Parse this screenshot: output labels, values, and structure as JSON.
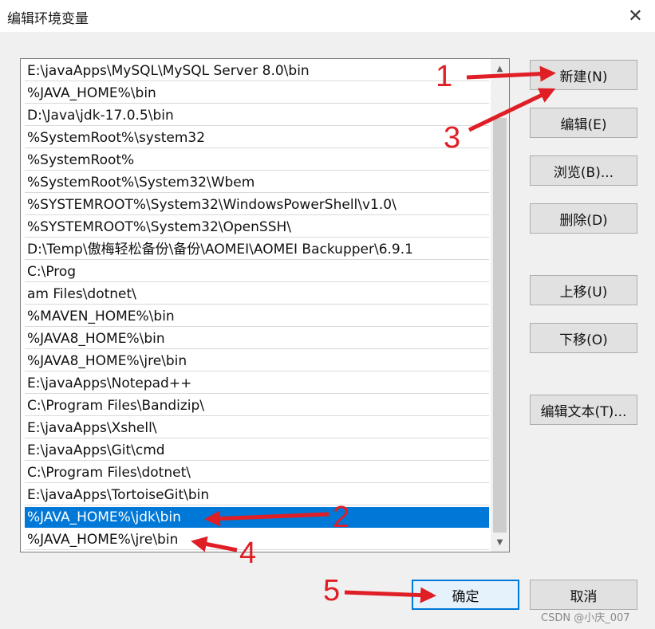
{
  "window": {
    "title": "编辑环境变量",
    "close_glyph": "✕"
  },
  "list": {
    "items": [
      "E:\\javaApps\\MySQL\\MySQL Server 8.0\\bin",
      "%JAVA_HOME%\\bin",
      "D:\\Java\\jdk-17.0.5\\bin",
      "%SystemRoot%\\system32",
      "%SystemRoot%",
      "%SystemRoot%\\System32\\Wbem",
      "%SYSTEMROOT%\\System32\\WindowsPowerShell\\v1.0\\",
      "%SYSTEMROOT%\\System32\\OpenSSH\\",
      "D:\\Temp\\傲梅轻松备份\\备份\\AOMEI\\AOMEI Backupper\\6.9.1",
      "C:\\Prog",
      "am Files\\dotnet\\",
      "%MAVEN_HOME%\\bin",
      "%JAVA8_HOME%\\bin",
      "%JAVA8_HOME%\\jre\\bin",
      "E:\\javaApps\\Notepad++",
      "C:\\Program Files\\Bandizip\\",
      "E:\\javaApps\\Xshell\\",
      "E:\\javaApps\\Git\\cmd",
      "C:\\Program Files\\dotnet\\",
      "E:\\javaApps\\TortoiseGit\\bin",
      "%JAVA_HOME%\\jdk\\bin",
      "%JAVA_HOME%\\jre\\bin"
    ],
    "selected_index": 20
  },
  "buttons": {
    "new": "新建(N)",
    "edit": "编辑(E)",
    "browse": "浏览(B)...",
    "delete": "删除(D)",
    "move_up": "上移(U)",
    "move_down": "下移(O)",
    "edit_text": "编辑文本(T)...",
    "ok": "确定",
    "cancel": "取消"
  },
  "annotations": {
    "n1": "1",
    "n2": "2",
    "n3": "3",
    "n4": "4",
    "n5": "5"
  },
  "watermark": "CSDN @小庆_007",
  "colors": {
    "selection": "#0078d7",
    "annotation": "#e01e25"
  }
}
